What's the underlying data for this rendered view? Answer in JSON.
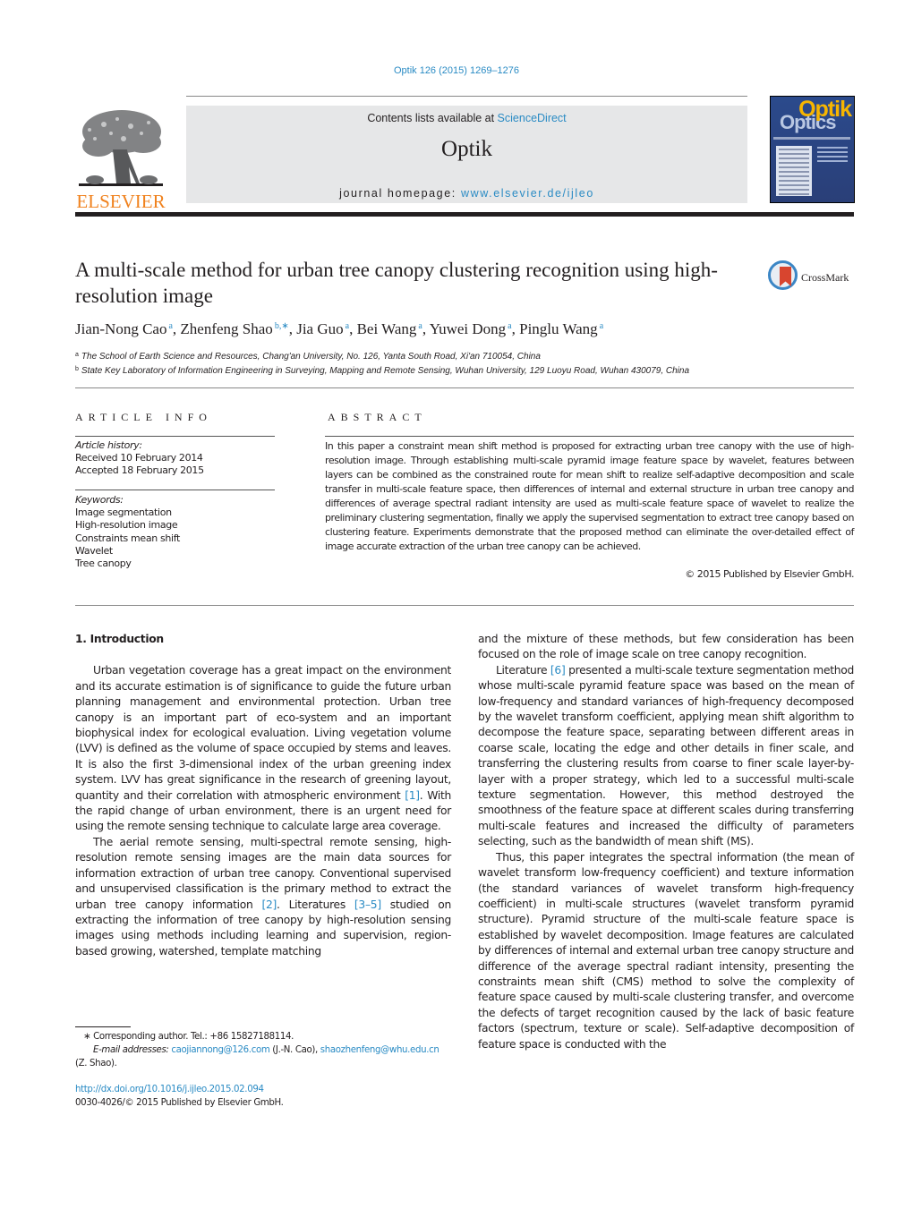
{
  "citation": "Optik 126 (2015) 1269–1276",
  "header": {
    "publisher_logo_text": "ELSEVIER",
    "contents_prefix": "Contents lists available at ",
    "contents_link": "ScienceDirect",
    "journal_name": "Optik",
    "homepage_prefix": "journal homepage: ",
    "homepage_link": "www.elsevier.de/ijleo",
    "cover": {
      "title_top": "Optik",
      "title_bottom": "Optics"
    },
    "colors": {
      "link": "#2a8bc4",
      "elsevier_orange": "#f0821e",
      "box_bg": "#e6e7e8"
    }
  },
  "article": {
    "title": "A multi-scale method for urban tree canopy clustering recognition using high-resolution image",
    "crossmark_label": "CrossMark",
    "authors": [
      {
        "name": "Jian-Nong Cao",
        "sup": "a"
      },
      {
        "name": "Zhenfeng Shao",
        "sup": "b,∗"
      },
      {
        "name": "Jia Guo",
        "sup": "a"
      },
      {
        "name": "Bei Wang",
        "sup": "a"
      },
      {
        "name": "Yuwei Dong",
        "sup": "a"
      },
      {
        "name": "Pinglu Wang",
        "sup": "a"
      }
    ],
    "affiliations": [
      {
        "mark": "a",
        "text": "The School of Earth Science and Resources, Chang'an University, No. 126, Yanta South Road, Xi'an 710054, China"
      },
      {
        "mark": "b",
        "text": "State Key Laboratory of Information Engineering in Surveying, Mapping and Remote Sensing, Wuhan University, 129 Luoyu Road, Wuhan 430079, China"
      }
    ]
  },
  "article_info": {
    "label": "ARTICLE INFO",
    "history_label": "Article history:",
    "received": "Received 10 February 2014",
    "accepted": "Accepted 18 February 2015",
    "keywords_label": "Keywords:",
    "keywords": [
      "Image segmentation",
      "High-resolution image",
      "Constraints mean shift",
      "Wavelet",
      "Tree canopy"
    ]
  },
  "abstract": {
    "label": "ABSTRACT",
    "text": "In this paper a constraint mean shift method is proposed for extracting urban tree canopy with the use of high-resolution image. Through establishing multi-scale pyramid image feature space by wavelet, features between layers can be combined as the constrained route for mean shift to realize self-adaptive decomposition and scale transfer in multi-scale feature space, then differences of internal and external structure in urban tree canopy and differences of average spectral radiant intensity are used as multi-scale feature space of wavelet to realize the preliminary clustering segmentation, finally we apply the supervised segmentation to extract tree canopy based on clustering feature. Experiments demonstrate that the proposed method can eliminate the over-detailed effect of image accurate extraction of the urban tree canopy can be achieved.",
    "copyright": "© 2015 Published by Elsevier GmbH."
  },
  "body": {
    "section_heading": "1.  Introduction",
    "p1": {
      "a": "Urban vegetation coverage has a great impact on the environment and its accurate estimation is of significance to guide the future urban planning management and environmental protection. Urban tree canopy is an important part of eco-system and an important biophysical index for ecological evaluation. Living vegetation volume (LVV) is defined as the volume of space occupied by stems and leaves. It is also the first 3-dimensional index of the urban greening index system. LVV has great significance in the research of greening layout, quantity and their correlation with atmospheric environment ",
      "ref1": "[1]",
      "b": ". With the rapid change of urban environment, there is an urgent need for using the remote sensing technique to calculate large area coverage."
    },
    "p2": {
      "a": "The aerial remote sensing, multi-spectral remote sensing, high-resolution remote sensing images are the main data sources for information extraction of urban tree canopy. Conventional supervised and unsupervised classification is the primary method to extract the urban tree canopy information ",
      "ref1": "[2]",
      "b": ". Literatures ",
      "ref2": "[3–5]",
      "c": " studied on extracting the information of tree canopy by high-resolution sensing images using methods including learning and supervision, region-based growing, watershed, template matching"
    },
    "p2_cont": "and the mixture of these methods, but few consideration has been focused on the role of image scale on tree canopy recognition.",
    "p3": {
      "a": "Literature ",
      "ref1": "[6]",
      "b": " presented a multi-scale texture segmentation method whose multi-scale pyramid feature space was based on the mean of low-frequency and standard variances of high-frequency decomposed by the wavelet transform coefficient, applying mean shift algorithm to decompose the feature space, separating between different areas in coarse scale, locating the edge and other details in finer scale, and transferring the clustering results from coarse to finer scale layer-by-layer with a proper strategy, which led to a successful multi-scale texture segmentation. However, this method destroyed the smoothness of the feature space at different scales during transferring multi-scale features and increased the difficulty of parameters selecting, such as the bandwidth of mean shift (MS)."
    },
    "p4": "Thus, this paper integrates the spectral information (the mean of wavelet transform low-frequency coefficient) and texture information (the standard variances of wavelet transform high-frequency coefficient) in multi-scale structures (wavelet transform pyramid structure). Pyramid structure of the multi-scale feature space is established by wavelet decomposition. Image features are calculated by differences of internal and external urban tree canopy structure and difference of the average spectral radiant intensity, presenting the constraints mean shift (CMS) method to solve the complexity of feature space caused by multi-scale clustering transfer, and overcome the defects of target recognition caused by the lack of basic feature factors (spectrum, texture or scale). Self-adaptive decomposition of feature space is conducted with the"
  },
  "footnotes": {
    "corresponding": "∗  Corresponding author. Tel.: +86 15827188114.",
    "email_label": "E-mail addresses: ",
    "email1": "caojiannong@126.com",
    "email1_owner": " (J.-N. Cao), ",
    "email2": "shaozhenfeng@whu.edu.cn",
    "email2_owner": "(Z. Shao).",
    "doi": "http://dx.doi.org/10.1016/j.ijleo.2015.02.094",
    "issn_copyright": "0030-4026/© 2015 Published by Elsevier GmbH."
  }
}
